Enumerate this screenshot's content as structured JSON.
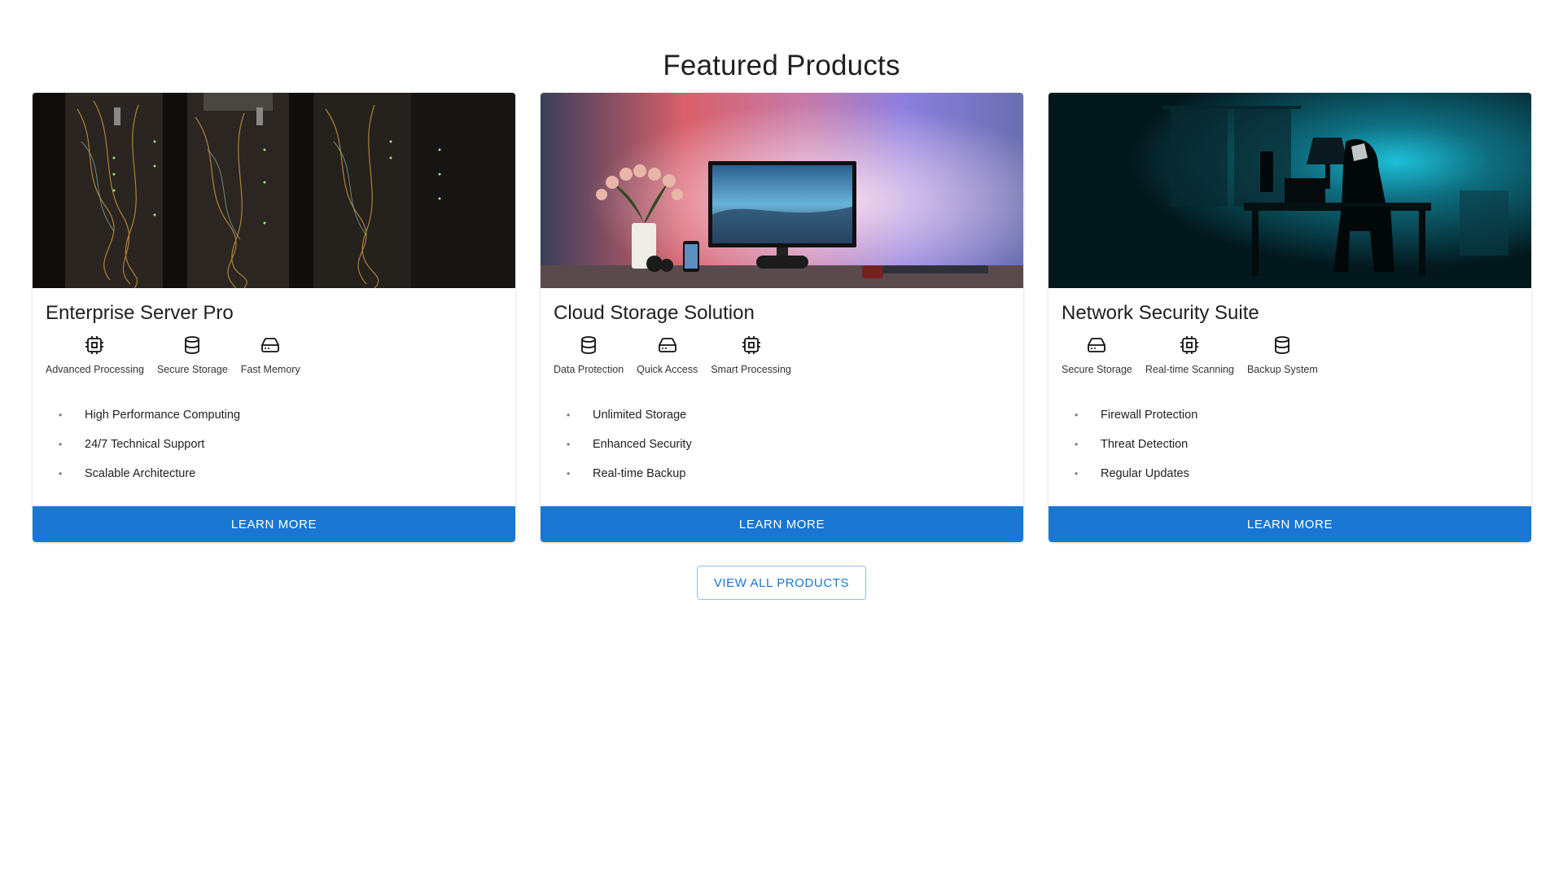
{
  "page": {
    "title": "Featured Products"
  },
  "colors": {
    "primary": "#1976d2",
    "text": "#1f1f1f",
    "background": "#ffffff"
  },
  "products": [
    {
      "title": "Enterprise Server Pro",
      "image": "server-rack-photo",
      "features": [
        {
          "icon": "cpu-icon",
          "label": "Advanced Processing"
        },
        {
          "icon": "database-icon",
          "label": "Secure Storage"
        },
        {
          "icon": "hard-drive-icon",
          "label": "Fast Memory"
        }
      ],
      "bullets": [
        "High Performance Computing",
        "24/7 Technical Support",
        "Scalable Architecture"
      ],
      "button_label": "Learn More"
    },
    {
      "title": "Cloud Storage Solution",
      "image": "desk-monitor-photo",
      "features": [
        {
          "icon": "database-icon",
          "label": "Data Protection"
        },
        {
          "icon": "hard-drive-icon",
          "label": "Quick Access"
        },
        {
          "icon": "cpu-icon",
          "label": "Smart Processing"
        }
      ],
      "bullets": [
        "Unlimited Storage",
        "Enhanced Security",
        "Real-time Backup"
      ],
      "button_label": "Learn More"
    },
    {
      "title": "Network Security Suite",
      "image": "hooded-figure-desk-photo",
      "features": [
        {
          "icon": "hard-drive-icon",
          "label": "Secure Storage"
        },
        {
          "icon": "cpu-icon",
          "label": "Real-time Scanning"
        },
        {
          "icon": "database-icon",
          "label": "Backup System"
        }
      ],
      "bullets": [
        "Firewall Protection",
        "Threat Detection",
        "Regular Updates"
      ],
      "button_label": "Learn More"
    }
  ],
  "view_all_label": "View All Products",
  "bullet_glyph": "•"
}
